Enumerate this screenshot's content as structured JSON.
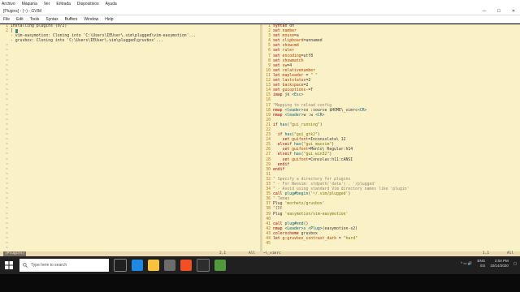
{
  "top_menu": [
    "Archivo",
    "Máquina",
    "Ver",
    "Entrada",
    "Dispositivos",
    "Ayuda"
  ],
  "window": {
    "title": "[Plugins] - (~) - GVIM",
    "minimize": "—",
    "maximize": "☐",
    "close": "✕"
  },
  "menubar": [
    "File",
    "Edit",
    "Tools",
    "Syntax",
    "Buffers",
    "Window",
    "Help"
  ],
  "left_pane": {
    "lines": [
      {
        "ln": "1",
        "text": "Installing plugins (0/2)"
      },
      {
        "ln": "2",
        "text": "[ ",
        "cursor": true
      },
      {
        "ln": "",
        "text": "- vim-easymotion: Cloning into 'C:\\Users\\IEUser\\.vim\\plugged\\vim-easymotion'..."
      },
      {
        "ln": "",
        "text": "- gruvbox: Cloning into 'C:\\Users\\IEUser\\.vim\\plugged\\gruvbox'..."
      }
    ],
    "tildes": 45
  },
  "right_pane": {
    "lines": [
      {
        "ln": "1",
        "code": [
          [
            "kw",
            "syntax"
          ],
          [
            "txt",
            " on"
          ]
        ]
      },
      {
        "ln": "2",
        "code": [
          [
            "kw",
            "set"
          ],
          [
            "op",
            " number"
          ]
        ]
      },
      {
        "ln": "3",
        "code": [
          [
            "kw",
            "set"
          ],
          [
            "op",
            " mouse"
          ],
          [
            "txt",
            "=a"
          ]
        ]
      },
      {
        "ln": "4",
        "code": [
          [
            "kw",
            "set"
          ],
          [
            "op",
            " clipboard"
          ],
          [
            "txt",
            "=unnamed"
          ]
        ]
      },
      {
        "ln": "5",
        "code": [
          [
            "kw",
            "set"
          ],
          [
            "op",
            " showcmd"
          ]
        ]
      },
      {
        "ln": "6",
        "code": [
          [
            "kw",
            "set"
          ],
          [
            "op",
            " ruler"
          ]
        ]
      },
      {
        "ln": "7",
        "code": [
          [
            "kw",
            "set"
          ],
          [
            "op",
            " encoding"
          ],
          [
            "txt",
            "=utf8"
          ]
        ]
      },
      {
        "ln": "8",
        "code": [
          [
            "kw",
            "set"
          ],
          [
            "op",
            " showmatch"
          ]
        ]
      },
      {
        "ln": "9",
        "code": [
          [
            "kw",
            "set"
          ],
          [
            "op",
            " sw"
          ],
          [
            "txt",
            "=4"
          ]
        ]
      },
      {
        "ln": "10",
        "code": [
          [
            "kw",
            "set"
          ],
          [
            "op",
            " relativenumber"
          ]
        ]
      },
      {
        "ln": "11",
        "code": [
          [
            "kw",
            "let"
          ],
          [
            "op",
            " mapleader"
          ],
          [
            "txt",
            " = "
          ],
          [
            "str",
            "\" \""
          ]
        ]
      },
      {
        "ln": "12",
        "code": [
          [
            "kw",
            "set"
          ],
          [
            "op",
            " laststatus"
          ],
          [
            "txt",
            "=2"
          ]
        ]
      },
      {
        "ln": "13",
        "code": [
          [
            "kw",
            "set"
          ],
          [
            "op",
            " backspace"
          ],
          [
            "txt",
            "=2"
          ]
        ]
      },
      {
        "ln": "14",
        "code": [
          [
            "kw",
            "set"
          ],
          [
            "op",
            " guioptions"
          ],
          [
            "txt",
            "-=T"
          ]
        ]
      },
      {
        "ln": "15",
        "code": [
          [
            "kw",
            "imap"
          ],
          [
            "txt",
            " jk "
          ],
          [
            "fn",
            "<Esc>"
          ]
        ]
      },
      {
        "ln": "16",
        "code": []
      },
      {
        "ln": "17",
        "code": [
          [
            "com",
            "\"Mapping to reload config"
          ]
        ]
      },
      {
        "ln": "18",
        "code": [
          [
            "kw",
            "nmap"
          ],
          [
            "fn",
            " <leader>"
          ],
          [
            "txt",
            "so :source $HOME\\_vimrc"
          ],
          [
            "fn",
            "<CR>"
          ]
        ]
      },
      {
        "ln": "19",
        "code": [
          [
            "kw",
            "nmap"
          ],
          [
            "fn",
            " <leader>"
          ],
          [
            "txt",
            "w :w "
          ],
          [
            "fn",
            "<CR>"
          ]
        ]
      },
      {
        "ln": "20",
        "code": []
      },
      {
        "ln": "21",
        "code": [
          [
            "kw",
            "if"
          ],
          [
            "fn",
            " has"
          ],
          [
            "txt",
            "("
          ],
          [
            "str",
            "\"gui_running\""
          ],
          [
            "txt",
            ")"
          ]
        ]
      },
      {
        "ln": "22",
        "code": []
      },
      {
        "ln": "23",
        "code": [
          [
            "kw",
            "  if"
          ],
          [
            "fn",
            " has"
          ],
          [
            "txt",
            "("
          ],
          [
            "str",
            "\"gui_gtk2\""
          ],
          [
            "txt",
            ")"
          ]
        ]
      },
      {
        "ln": "24",
        "code": [
          [
            "kw",
            "    set"
          ],
          [
            "op",
            " guifont"
          ],
          [
            "txt",
            "=Inconsolata\\ 12"
          ]
        ]
      },
      {
        "ln": "25",
        "code": [
          [
            "kw",
            "  elseif"
          ],
          [
            "fn",
            " has"
          ],
          [
            "txt",
            "("
          ],
          [
            "str",
            "\"gui_macvim\""
          ],
          [
            "txt",
            ")"
          ]
        ]
      },
      {
        "ln": "26",
        "code": [
          [
            "kw",
            "    set"
          ],
          [
            "op",
            " guifont"
          ],
          [
            "txt",
            "=Menlo\\ Regular:h14"
          ]
        ]
      },
      {
        "ln": "27",
        "code": [
          [
            "kw",
            "  elseif"
          ],
          [
            "fn",
            " has"
          ],
          [
            "txt",
            "("
          ],
          [
            "str",
            "\"gui_win32\""
          ],
          [
            "txt",
            ")"
          ]
        ]
      },
      {
        "ln": "28",
        "code": [
          [
            "kw",
            "    set"
          ],
          [
            "op",
            " guifont"
          ],
          [
            "txt",
            "=Consolas:h11:cANSI"
          ]
        ]
      },
      {
        "ln": "29",
        "code": [
          [
            "kw",
            "  endif"
          ]
        ]
      },
      {
        "ln": "30",
        "code": [
          [
            "kw",
            "endif"
          ]
        ]
      },
      {
        "ln": "31",
        "code": []
      },
      {
        "ln": "32",
        "code": [
          [
            "com",
            "\" Specify a directory for plugins"
          ]
        ]
      },
      {
        "ln": "33",
        "code": [
          [
            "com",
            "\" - For Neovim: stdpath('data') . '/plugged'"
          ]
        ]
      },
      {
        "ln": "34",
        "code": [
          [
            "com",
            "\" - Avoid using standard Vim directory names like 'plugin'"
          ]
        ]
      },
      {
        "ln": "35",
        "code": [
          [
            "kw",
            "call"
          ],
          [
            "fn",
            " plug#begin"
          ],
          [
            "txt",
            "("
          ],
          [
            "str",
            "'~/.vim/plugged'"
          ],
          [
            "txt",
            ")"
          ]
        ]
      },
      {
        "ln": "36",
        "code": [
          [
            "com",
            "\" Temas"
          ]
        ]
      },
      {
        "ln": "37",
        "code": [
          [
            "txt",
            "Plug "
          ],
          [
            "str",
            "'morhetz/gruvbox'"
          ]
        ]
      },
      {
        "ln": "38",
        "code": [
          [
            "com",
            "\"IDE"
          ]
        ]
      },
      {
        "ln": "39",
        "code": [
          [
            "txt",
            "Plug "
          ],
          [
            "str",
            "'easymotion/vim-easymotion'"
          ]
        ]
      },
      {
        "ln": "40",
        "code": []
      },
      {
        "ln": "41",
        "code": [
          [
            "kw",
            "call"
          ],
          [
            "fn",
            " plug#end"
          ],
          [
            "txt",
            "()"
          ]
        ]
      },
      {
        "ln": "42",
        "code": [
          [
            "kw",
            "nmap"
          ],
          [
            "fn",
            " <Leader>s"
          ],
          [
            "fn",
            " <Plug>"
          ],
          [
            "txt",
            "(easymotion-s2)"
          ]
        ]
      },
      {
        "ln": "43",
        "code": [
          [
            "kw",
            "colorscheme"
          ],
          [
            "txt",
            " gruvbox"
          ]
        ]
      },
      {
        "ln": "44",
        "code": [
          [
            "kw",
            "let"
          ],
          [
            "op",
            " g:gruvbox_contrast_dark"
          ],
          [
            "txt",
            " = "
          ],
          [
            "str",
            "\"hard\""
          ]
        ]
      },
      {
        "ln": "45",
        "code": []
      }
    ]
  },
  "status": {
    "left_name": "[Plugins]",
    "left_pos": "2,1",
    "left_all": "All",
    "right_name": "~\\_vimrc",
    "right_pos": "1,1",
    "right_all": "All"
  },
  "taskbar": {
    "search_placeholder": "Type here to search",
    "tray_lang": "ENG",
    "tray_region": "ES",
    "time": "2:04 PM",
    "date": "10/14/2020"
  },
  "colors": {
    "bg": "#fbf1c7",
    "keyword": "#9d0006",
    "string": "#79740e",
    "comment": "#928374"
  }
}
